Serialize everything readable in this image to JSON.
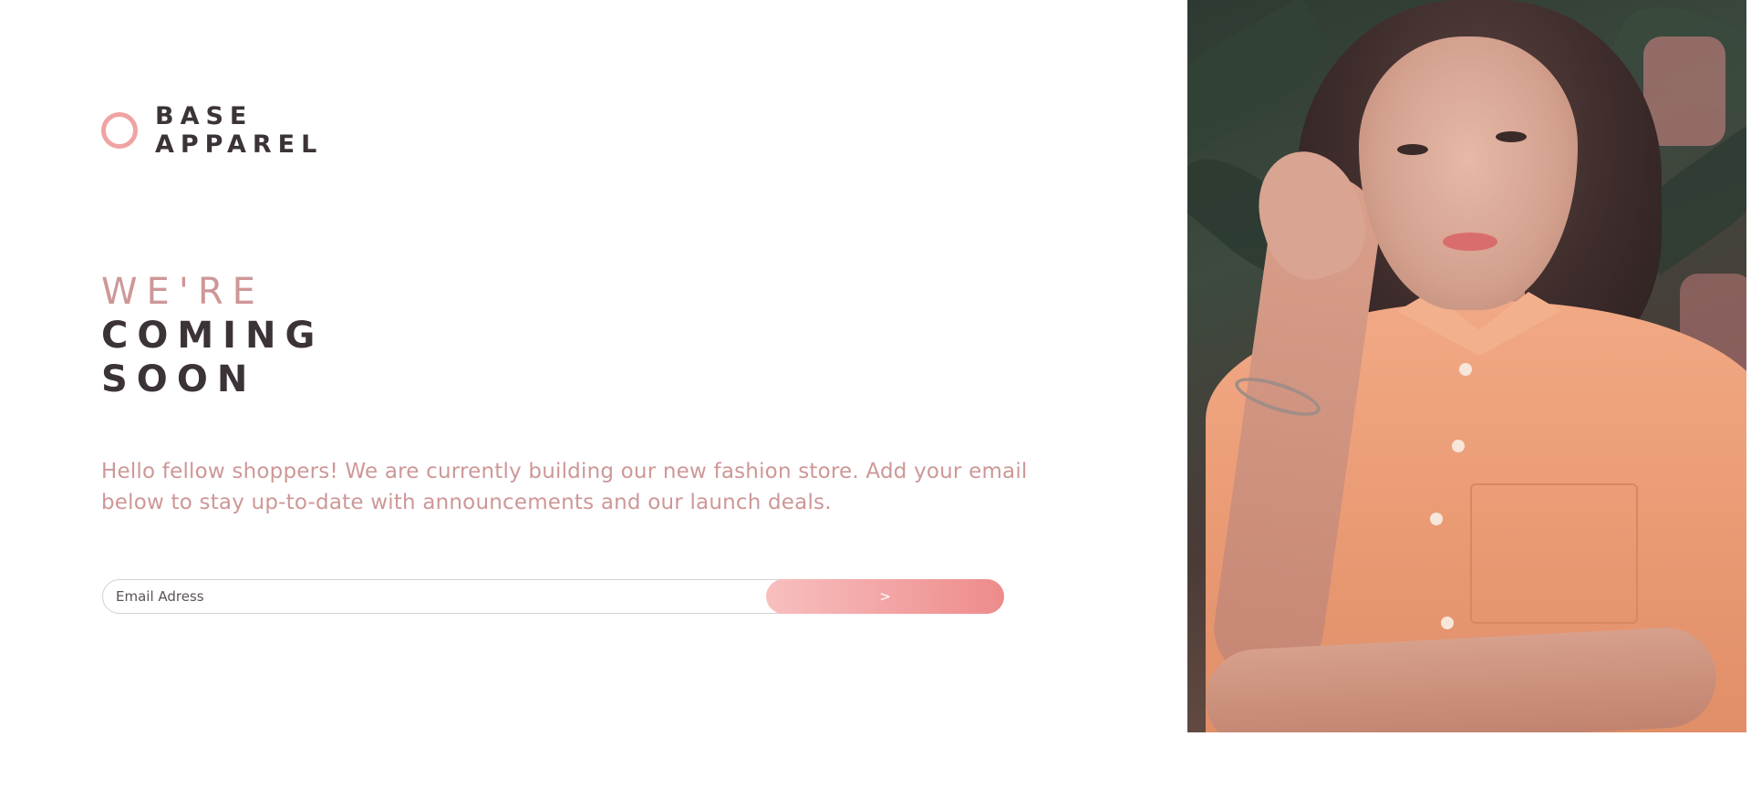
{
  "brand": {
    "line1": "BASE",
    "line2": "APPAREL"
  },
  "headline": {
    "line1": "WE'RE",
    "line2": "COMING",
    "line3": "SOON"
  },
  "description": "Hello fellow shoppers! We are currently building our new fashion store. Add your email below to stay up-to-date with announcements and our launch deals.",
  "form": {
    "email_placeholder": "Email Adress",
    "submit_label": ">"
  },
  "hero": {
    "alt": "Woman in an orange shirt in front of tropical plants"
  },
  "colors": {
    "accent_pink": "#ce9797",
    "dark_text": "#3b3338",
    "button_gradient_start": "#f8bfbf",
    "button_gradient_end": "#ee8b8b"
  },
  "icons": {
    "logo": "ring-logo-icon"
  }
}
